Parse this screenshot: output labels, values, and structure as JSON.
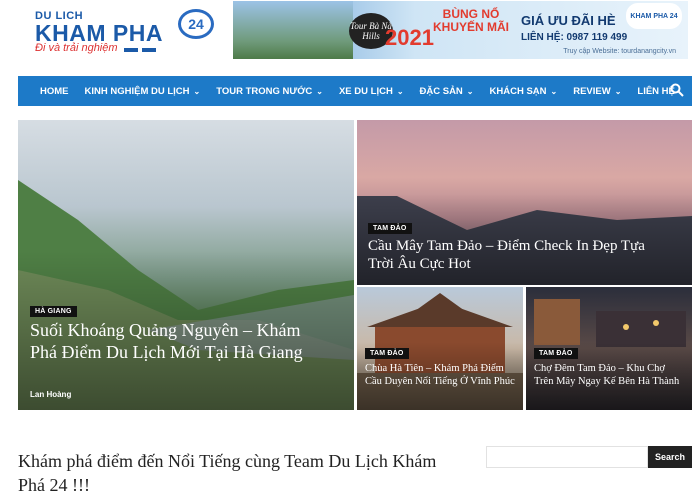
{
  "logo": {
    "small": "DU LICH",
    "big": "KHAM PHA",
    "badge": "24",
    "tagline": "Đi và trải nghiệm"
  },
  "ad": {
    "tour_logo": "Tour Bà Nà Hills",
    "burst_line1": "BÙNG NỔ",
    "burst_line2": "KHUYẾN MÃI",
    "year": "2021",
    "price": "GIÁ ƯU ĐÃI HÈ",
    "contact": "LIÊN HỆ: 0987 119 499",
    "brand": "KHAM PHA 24",
    "site": "Truy cập Website: tourdanangcity.vn"
  },
  "nav": {
    "items": [
      {
        "label": "HOME"
      },
      {
        "label": "KINH NGHIỆM DU LỊCH",
        "caret": "⌄"
      },
      {
        "label": "TOUR TRONG NƯỚC",
        "caret": "⌄"
      },
      {
        "label": "XE DU LỊCH",
        "caret": "⌄"
      },
      {
        "label": "ĐẶC SẢN",
        "caret": "⌄"
      },
      {
        "label": "KHÁCH SẠN",
        "caret": "⌄"
      },
      {
        "label": "REVIEW",
        "caret": "⌄"
      },
      {
        "label": "LIÊN HỆ"
      }
    ]
  },
  "posts": [
    {
      "category": "HÀ GIANG",
      "title": "Suối Khoáng Quảng Nguyên – Khám Phá Điểm Du Lịch Mới Tại Hà Giang",
      "author": "Lan Hoàng"
    },
    {
      "category": "TAM ĐẢO",
      "title": "Cầu Mây Tam Đảo – Điểm Check In Đẹp Tựa Trời Âu Cực Hot"
    },
    {
      "category": "TAM ĐẢO",
      "title": "Chùa Hà Tiên – Khám Phá Điểm Cầu Duyên Nổi Tiếng Ở Vĩnh Phúc"
    },
    {
      "category": "TAM ĐẢO",
      "title": "Chợ Đêm Tam Đảo – Khu Chợ Trên Mây Ngay Kế Bên Hà Thành"
    }
  ],
  "section": {
    "heading": "Khám phá điểm đến Nổi Tiếng cùng Team Du Lịch Khám Phá 24 !!!"
  },
  "search": {
    "placeholder": "",
    "button": "Search"
  }
}
